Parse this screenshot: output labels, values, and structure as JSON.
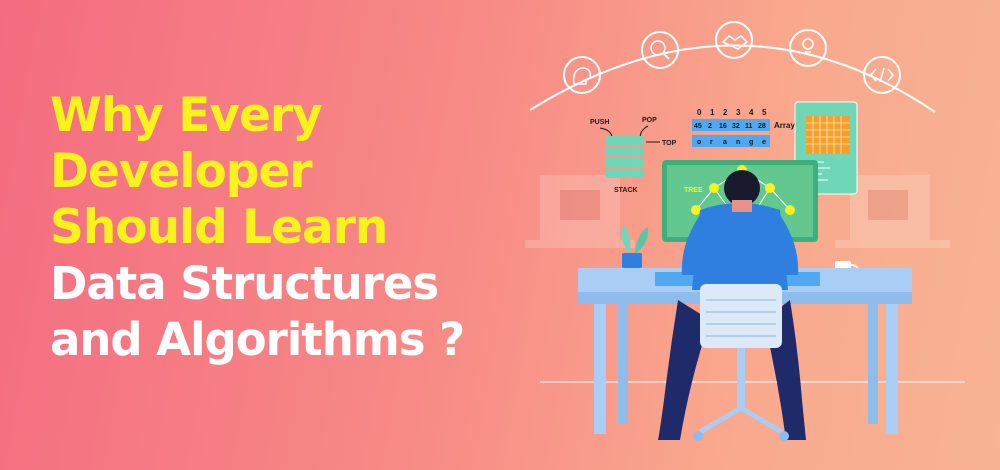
{
  "headline": {
    "line1": "Why Every",
    "line2": "Developer",
    "line3": "Should Learn",
    "line4": "Data Structures",
    "line5": "and Algorithms ?"
  },
  "illustration": {
    "stack": {
      "push": "PUSH",
      "pop": "POP",
      "top": "TOP",
      "label": "STACK"
    },
    "array": {
      "indices": [
        "0",
        "1",
        "2",
        "3",
        "4",
        "5"
      ],
      "values": [
        "45",
        "2",
        "16",
        "32",
        "11",
        "28"
      ],
      "chars": [
        "o",
        "r",
        "a",
        "n",
        "g",
        "e"
      ],
      "label": "Array"
    },
    "monitor": {
      "tree_label": "TREE"
    },
    "arc_icons": [
      "idea-head-icon",
      "question-search-icon",
      "handshake-icon",
      "lightbulb-person-icon",
      "code-brackets-icon"
    ]
  },
  "colors": {
    "headline_yellow": "#f8f21d",
    "headline_white": "#ffffff",
    "shirt_blue": "#2f7fe0",
    "desk_blue": "#a9cdf4",
    "stack_green": "#6fd6b8",
    "tile_blue": "#4fa8f0"
  }
}
